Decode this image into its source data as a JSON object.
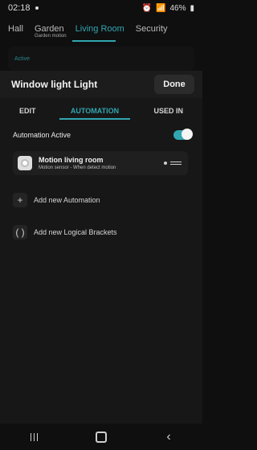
{
  "status": {
    "time": "02:18",
    "battery": "46%"
  },
  "background_tabs": [
    {
      "label": "Hall",
      "sub": ""
    },
    {
      "label": "Garden",
      "sub": "Garden motion"
    },
    {
      "label": "Living Room",
      "sub": ""
    },
    {
      "label": "Security",
      "sub": ""
    }
  ],
  "background_active": "Active",
  "header": {
    "title": "Window light Light",
    "done": "Done"
  },
  "tabs": {
    "edit": "EDIT",
    "automation": "AUTOMATION",
    "used_in": "USED IN"
  },
  "automation_active_label": "Automation Active",
  "automation_active": true,
  "automation": {
    "title": "Motion living room",
    "subtitle": "Motion sensor - When detect motion"
  },
  "add_automation": "Add new Automation",
  "add_brackets": "Add new Logical Brackets",
  "brackets_symbol": "( )",
  "add_symbol": "+",
  "colors": {
    "accent": "#31a6b0",
    "background": "#0f0f0f"
  }
}
